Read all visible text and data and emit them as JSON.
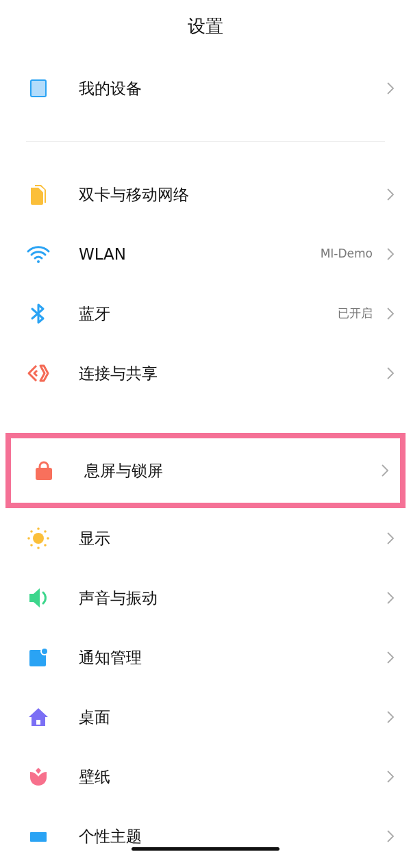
{
  "title": "设置",
  "sections": [
    {
      "items": [
        {
          "kind": "device",
          "label": "我的设备",
          "highlighted": false
        }
      ]
    },
    {
      "items": [
        {
          "kind": "sim",
          "label": "双卡与移动网络",
          "highlighted": false
        },
        {
          "kind": "wifi",
          "label": "WLAN",
          "value": "MI-Demo",
          "highlighted": false
        },
        {
          "kind": "bluetooth",
          "label": "蓝牙",
          "value": "已开启",
          "highlighted": false
        },
        {
          "kind": "share",
          "label": "连接与共享",
          "highlighted": false
        }
      ]
    },
    {
      "items": [
        {
          "kind": "lock",
          "label": "息屏与锁屏",
          "highlighted": true
        },
        {
          "kind": "sun",
          "label": "显示",
          "highlighted": false
        },
        {
          "kind": "sound",
          "label": "声音与振动",
          "highlighted": false
        },
        {
          "kind": "notify",
          "label": "通知管理",
          "highlighted": false
        },
        {
          "kind": "home",
          "label": "桌面",
          "highlighted": false
        },
        {
          "kind": "flower",
          "label": "壁纸",
          "highlighted": false
        },
        {
          "kind": "theme",
          "label": "个性主题",
          "highlighted": false
        }
      ]
    }
  ]
}
